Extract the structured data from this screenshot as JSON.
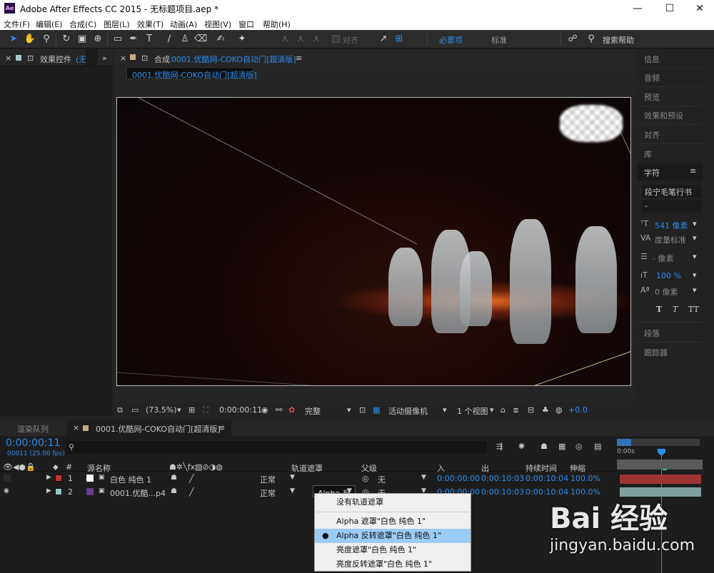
{
  "window": {
    "title": "Adobe After Effects CC 2015 - 无标题项目.aep *",
    "app_icon": "Ae",
    "minimize": "—",
    "maximize": "☐",
    "close": "✕"
  },
  "menu": [
    "文件(F)",
    "编辑(E)",
    "合成(C)",
    "图层(L)",
    "效果(T)",
    "动画(A)",
    "视图(V)",
    "窗口",
    "帮助(H)"
  ],
  "toolbar": {
    "align_label": "对齐",
    "workspace_essentials": "必要项",
    "workspace_standard": "标准",
    "search_help": "搜索帮助"
  },
  "left_panel": {
    "tab_label": "效果控件",
    "tab_suffix": "(无"
  },
  "composition_panel": {
    "tab_prefix": "合成",
    "tab_name": "0001.优酷网-COKO自动门[超清版]",
    "subtab": "0001.优酷网-COKO自动门[超清版]"
  },
  "viewer_bar": {
    "zoom": "(73.5%)",
    "timecode": "0:00:00:11",
    "resolution": "完整",
    "camera": "活动摄像机",
    "views": "1 个视图",
    "exposure": "+0.0"
  },
  "right_panel": {
    "items": [
      "信息",
      "音频",
      "预览",
      "效果和预设",
      "对齐",
      "库"
    ],
    "character": {
      "title": "字符",
      "font": "段宁毛笔行书",
      "style": "-",
      "size": "541 像素",
      "kerning": "度量标准",
      "leading": "- 像素",
      "scale": "100 %",
      "baseline": "0 像素"
    },
    "bottom_items": [
      "段落",
      "跟踪器"
    ]
  },
  "timeline": {
    "tab_render": "渲染队列",
    "tab_comp": "0001.优酷网-COKO自动门[超清版]",
    "current_time": "0:00:00:11",
    "frame_info": "00011 (25.00 fps)",
    "ruler_start": "0:00s",
    "headers": {
      "hash": "#",
      "source_name": "源名称",
      "track_matte": "轨道遮罩",
      "parent": "父级",
      "in": "入",
      "out": "出",
      "duration": "持续时间",
      "stretch": "伸缩"
    },
    "layers": [
      {
        "num": "1",
        "name": "白色 纯色 1",
        "mode": "正常",
        "matte": "",
        "parent": "无",
        "in": "0:00:00:00",
        "out": "0:00:10:03",
        "duration": "0:00:10:04",
        "stretch": "100.0%",
        "label_color": "#c83232",
        "track_color": "#a03434"
      },
      {
        "num": "2",
        "name": "0001.优酷...p4",
        "mode": "正常",
        "matte": "Alpha 反",
        "parent": "无",
        "in": "0:00:00:00",
        "out": "0:00:10:03",
        "duration": "0:00:10:04",
        "stretch": "100.0%",
        "label_color": "#8fc9c4",
        "track_color": "#7f9f9c"
      }
    ]
  },
  "matte_menu": {
    "items": [
      "没有轨道遮罩",
      "Alpha 遮罩\"白色 纯色 1\"",
      "Alpha 反转遮罩\"白色 纯色 1\"",
      "亮度遮罩\"白色 纯色 1\"",
      "亮度反转遮罩\"白色 纯色 1\""
    ],
    "selected_index": 2
  },
  "watermark": {
    "brand": "Bai 经验",
    "url": "jingyan.baidu.com"
  },
  "colors": {
    "accent_blue": "#2d8ceb",
    "menu_selected": "#9ccbf5"
  }
}
